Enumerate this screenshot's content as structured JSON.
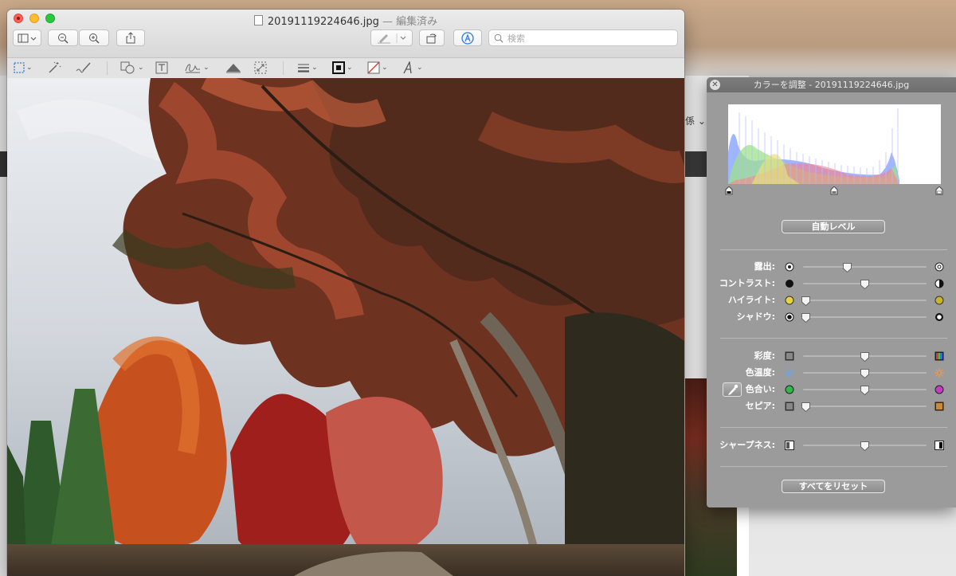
{
  "window": {
    "filename": "20191119224646.jpg",
    "status": " — 編集済み",
    "search_placeholder": "検索"
  },
  "background_window": {
    "menu_fragment": "係"
  },
  "panel": {
    "title": "カラーを調整 - 20191119224646.jpg",
    "auto_levels": "自動レベル",
    "reset_all": "すべてをリセット",
    "sliders": [
      {
        "key": "exposure",
        "label": "露出:",
        "value": 0.36
      },
      {
        "key": "contrast",
        "label": "コントラスト:",
        "value": 0.5
      },
      {
        "key": "highlights",
        "label": "ハイライト:",
        "value": 0.02
      },
      {
        "key": "shadows",
        "label": "シャドウ:",
        "value": 0.02
      },
      {
        "key": "saturation",
        "label": "彩度:",
        "value": 0.5
      },
      {
        "key": "temperature",
        "label": "色温度:",
        "value": 0.5
      },
      {
        "key": "tint",
        "label": "色合い:",
        "value": 0.5
      },
      {
        "key": "sepia",
        "label": "セピア:",
        "value": 0.02
      },
      {
        "key": "sharpness",
        "label": "シャープネス:",
        "value": 0.5
      }
    ]
  },
  "colors": {
    "close_red": "#fe5f57",
    "minimize_yellow": "#febc2e",
    "zoom_green": "#28c840",
    "markup_accent": "#2a7ae2",
    "panel_bg": "#9b9b9b"
  },
  "icons": [
    "sidebar-icon",
    "zoom-out-icon",
    "zoom-in-icon",
    "share-icon",
    "pen-icon",
    "rotate-icon",
    "markup-icon",
    "search-icon",
    "rect-select-icon",
    "magic-wand-icon",
    "sketch-icon",
    "shapes-icon",
    "text-icon",
    "sign-icon",
    "adjust-color-icon",
    "resize-icon",
    "line-style-icon",
    "border-color-icon",
    "fill-color-icon",
    "font-icon",
    "eyedropper-icon"
  ]
}
